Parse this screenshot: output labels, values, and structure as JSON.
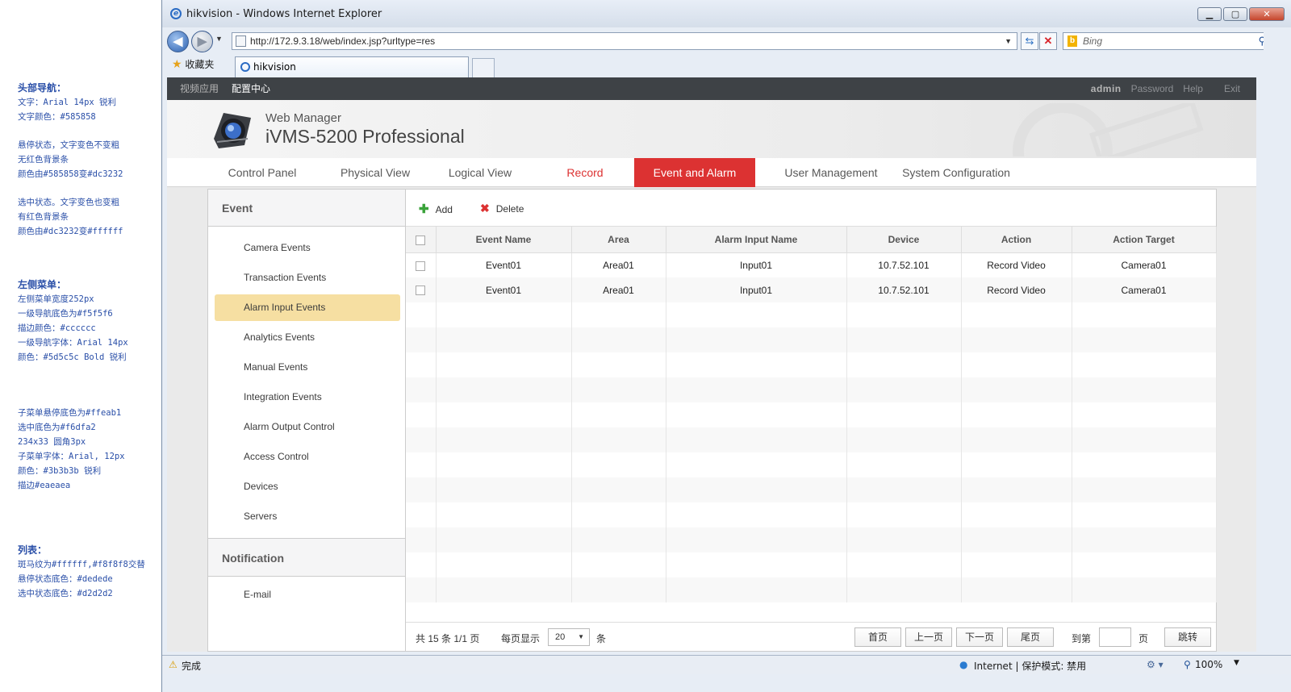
{
  "notes": {
    "b1": [
      "头部导航：",
      "文字：Arial 14px  锐利",
      "文字颜色：#585858",
      "",
      "悬停状态，文字变色不变粗",
      "无红色背景条",
      "颜色由#585858变#dc3232",
      "",
      "选中状态。文字变色也变粗",
      "有红色背景条",
      "颜色由#dc3232变#ffffff"
    ],
    "b2": [
      "左侧菜单：",
      "左侧菜单宽度252px",
      "一级导航底色为#f5f5f6",
      "描边颜色：#cccccc",
      "一级导航字体：Arial  14px",
      "颜色：#5d5c5c  Bold  锐利"
    ],
    "b3": [
      "子菜单悬停底色为#ffeab1",
      "选中底色为#f6dfa2",
      "234x33  圆角3px",
      "子菜单字体：Arial, 12px",
      "颜色：#3b3b3b  锐利",
      "描边#eaeaea"
    ],
    "b4": [
      "列表：",
      "斑马纹为#ffffff,#f8f8f8交替",
      "悬停状态底色：#dedede",
      "选中状态底色：#d2d2d2"
    ]
  },
  "browser": {
    "title": "hikvision - Windows Internet Explorer",
    "url": "http://172.9.3.18/web/index.jsp?urltype=res",
    "search_placeholder": "Bing",
    "favorites": "收藏夹",
    "tab_title": "hikvision",
    "status_left": "完成",
    "status_zone": "Internet | 保护模式: 禁用",
    "zoom": "100%"
  },
  "topnav": {
    "video": "视频应用",
    "config": "配置中心",
    "user": "admin",
    "password": "Password",
    "help": "Help",
    "exit": "Exit"
  },
  "banner": {
    "web_manager": "Web Manager",
    "product": "iVMS-5200 Professional"
  },
  "menu": [
    "Control Panel",
    "Physical View",
    "Logical View",
    "Record",
    "Event and Alarm",
    "User Management",
    "System Configuration"
  ],
  "left": {
    "event_header": "Event",
    "items": [
      "Camera Events",
      "Transaction Events",
      "Alarm Input Events",
      "Analytics Events",
      "Manual Events",
      "Integration Events",
      "Alarm Output Control",
      "Access Control",
      "Devices",
      "Servers"
    ],
    "notification_header": "Notification",
    "notification_items": [
      "E-mail"
    ]
  },
  "toolbar": {
    "add": "Add",
    "delete": "Delete"
  },
  "table": {
    "headers": [
      "Event Name",
      "Area",
      "Alarm Input Name",
      "Device",
      "Action",
      "Action Target"
    ],
    "rows": [
      [
        "Event01",
        "Area01",
        "Input01",
        "10.7.52.101",
        "Record Video",
        "Camera01"
      ],
      [
        "Event01",
        "Area01",
        "Input01",
        "10.7.52.101",
        "Record Video",
        "Camera01"
      ]
    ]
  },
  "pager": {
    "total": "共 15 条  1/1 页",
    "per_page": "每页显示",
    "per_page_value": "20",
    "unit": "条",
    "first": "首页",
    "prev": "上一页",
    "next": "下一页",
    "last": "尾页",
    "goto": "到第",
    "page": "页",
    "jump": "跳转"
  },
  "colors": {
    "accent": "#dc3232",
    "selected_sub": "#f6dfa2"
  }
}
